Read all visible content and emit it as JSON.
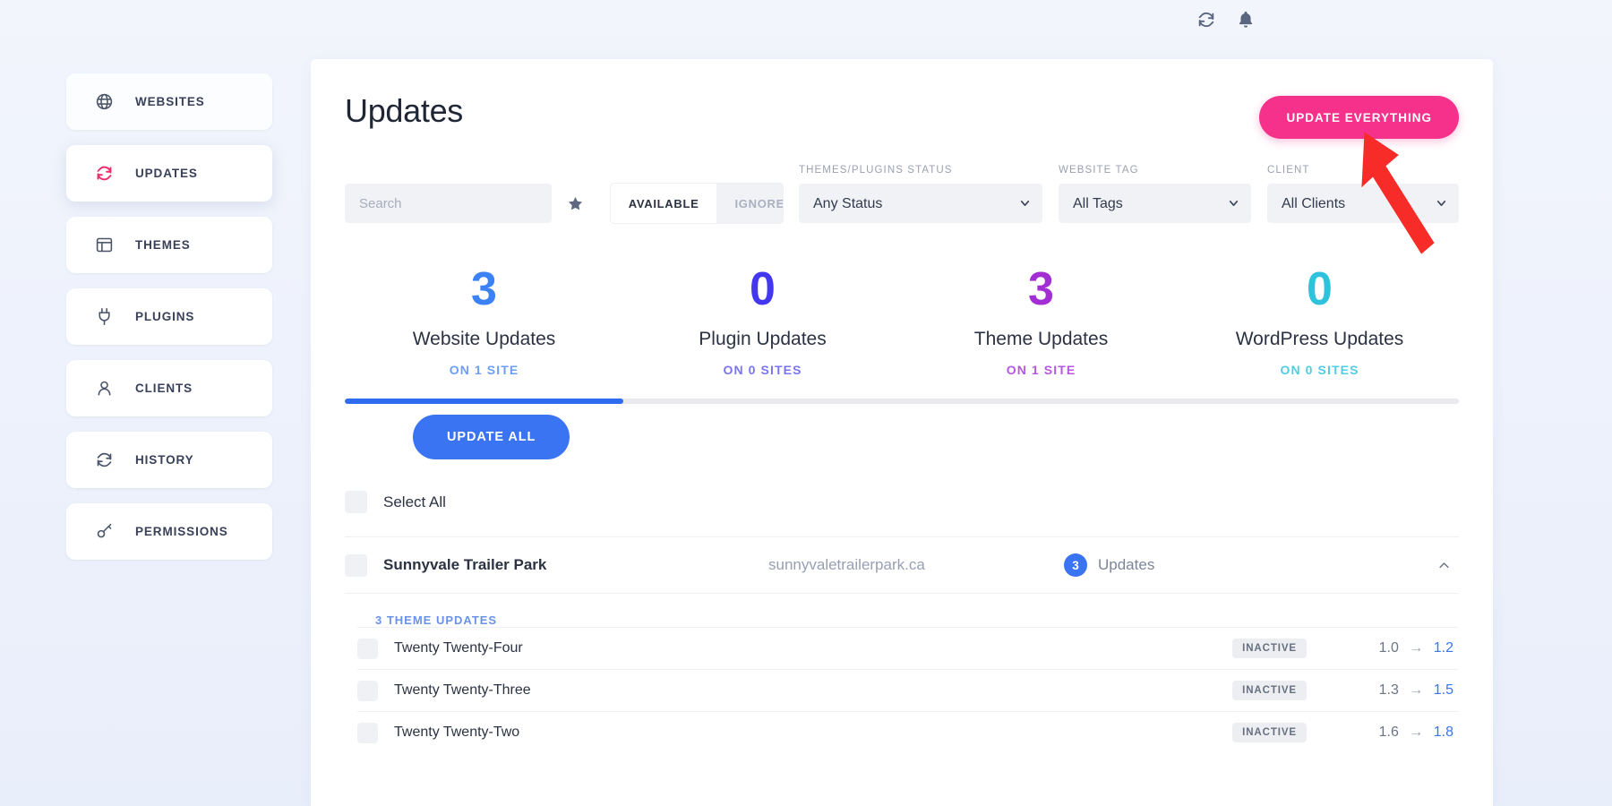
{
  "topbar": {
    "icons": [
      {
        "name": "sync-icon",
        "label": "Sync"
      },
      {
        "name": "bell-icon",
        "label": "Notifications"
      }
    ]
  },
  "sidebar": {
    "items": [
      {
        "label": "WEBSITES",
        "icon": "globe-icon",
        "active": false
      },
      {
        "label": "UPDATES",
        "icon": "sync-icon",
        "active": true
      },
      {
        "label": "THEMES",
        "icon": "layout-icon",
        "active": false
      },
      {
        "label": "PLUGINS",
        "icon": "plug-icon",
        "active": false
      },
      {
        "label": "CLIENTS",
        "icon": "user-icon",
        "active": false
      },
      {
        "label": "HISTORY",
        "icon": "sync-icon",
        "active": false
      },
      {
        "label": "PERMISSIONS",
        "icon": "key-icon",
        "active": false
      }
    ]
  },
  "page": {
    "title": "Updates",
    "update_everything_label": "UPDATE EVERYTHING",
    "accent_pink": "#f5318c",
    "accent_blue": "#3b74f2"
  },
  "filters": {
    "search_placeholder": "Search",
    "search_value": "",
    "favorite_icon": "star-icon",
    "segment": {
      "available_label": "AVAILABLE",
      "ignored_label": "IGNORED",
      "selected": "AVAILABLE"
    },
    "status": {
      "label": "THEMES/PLUGINS STATUS",
      "value": "Any Status",
      "options": [
        "Any Status"
      ]
    },
    "tag": {
      "label": "WEBSITE TAG",
      "value": "All Tags",
      "options": [
        "All Tags"
      ]
    },
    "client": {
      "label": "CLIENT",
      "value": "All Clients",
      "options": [
        "All Clients"
      ]
    }
  },
  "stats": [
    {
      "count": "3",
      "name": "Website Updates",
      "sites": "ON 1 SITE",
      "color": "#3b82f6"
    },
    {
      "count": "0",
      "name": "Plugin Updates",
      "sites": "ON 0 SITES",
      "color": "#4338f0"
    },
    {
      "count": "3",
      "name": "Theme Updates",
      "sites": "ON 1 SITE",
      "color": "#a32ed4"
    },
    {
      "count": "0",
      "name": "WordPress Updates",
      "sites": "ON 0 SITES",
      "color": "#2ec2dd"
    }
  ],
  "progress": {
    "percent": 25,
    "fill_color": "#2f6bf0",
    "update_all_label": "UPDATE ALL"
  },
  "list": {
    "select_all_label": "Select All",
    "site": {
      "name": "Sunnyvale Trailer Park",
      "url": "sunnyvaletrailerpark.ca",
      "update_count": "3",
      "updates_label": "Updates",
      "collapse_icon": "chevron-up-icon"
    },
    "group_header": "3 THEME UPDATES",
    "themes": [
      {
        "name": "Twenty Twenty-Four",
        "status": "INACTIVE",
        "from": "1.0",
        "to": "1.2"
      },
      {
        "name": "Twenty Twenty-Three",
        "status": "INACTIVE",
        "from": "1.3",
        "to": "1.5"
      },
      {
        "name": "Twenty Twenty-Two",
        "status": "INACTIVE",
        "from": "1.6",
        "to": "1.8"
      }
    ],
    "version_arrow": "→"
  }
}
